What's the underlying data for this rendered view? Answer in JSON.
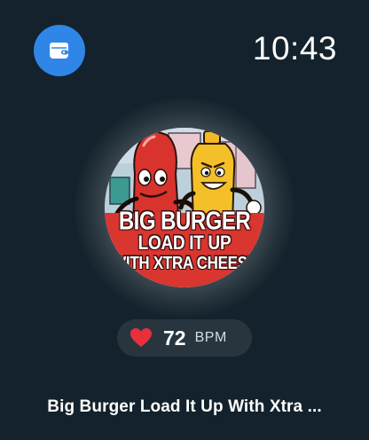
{
  "status_bar": {
    "time": "10:43",
    "wallet_icon": "wallet-icon",
    "wallet_color": "#2f86e6"
  },
  "artwork": {
    "line1": "BIG BURGER",
    "line2": "LOAD IT UP",
    "line3": "WITH XTRA CHEESE"
  },
  "heart_rate": {
    "icon": "heart-icon",
    "value": "72",
    "unit": "BPM"
  },
  "now_playing": {
    "title": "Big Burger Load It Up With Xtra ..."
  },
  "colors": {
    "background": "#13222c",
    "pill": "#28353f",
    "heart": "#e8303c"
  }
}
